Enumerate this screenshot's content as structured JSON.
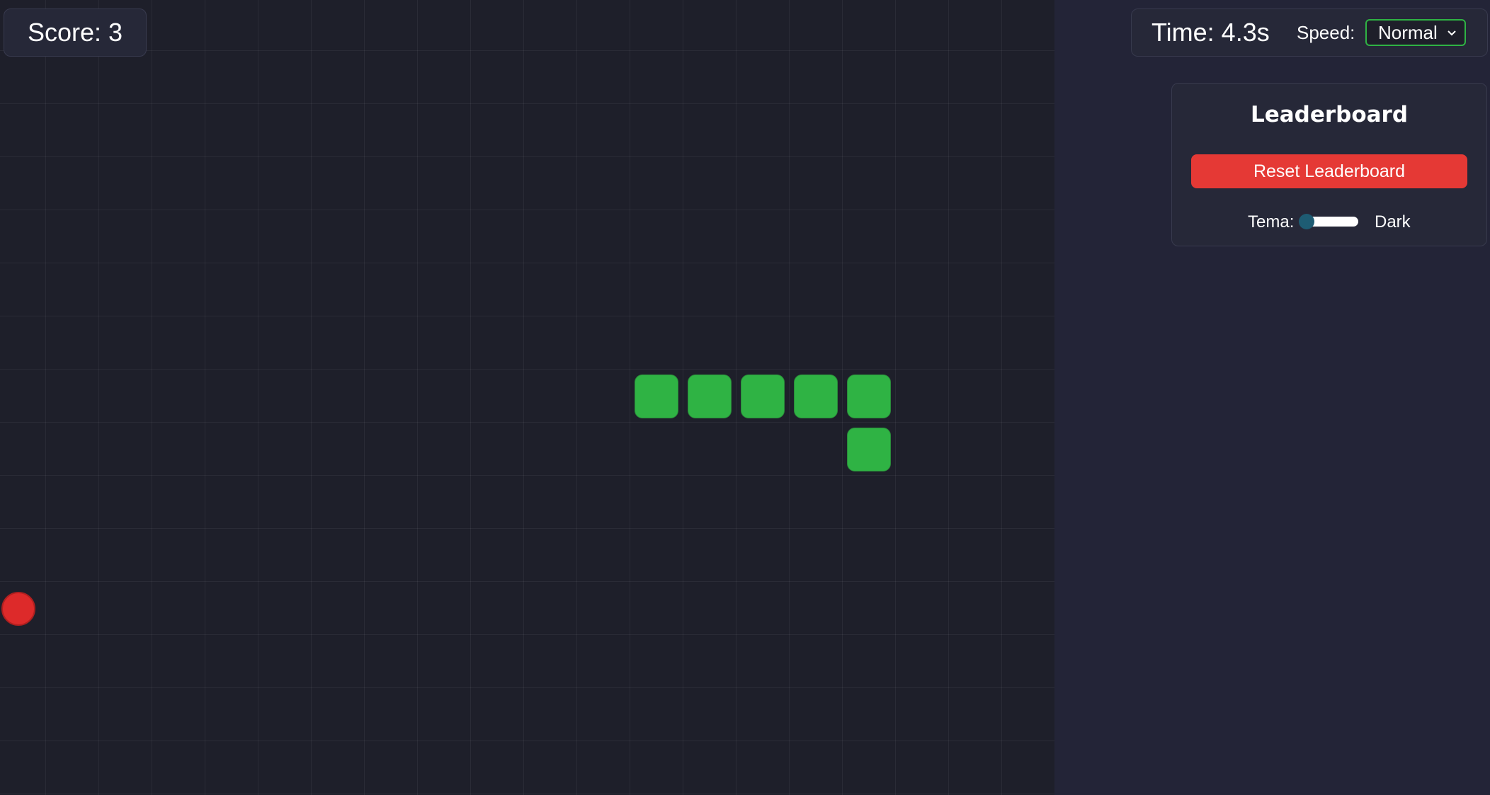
{
  "score": {
    "label": "Score: 3",
    "value": 3
  },
  "timer": {
    "label": "Time: 4.3s"
  },
  "speed": {
    "label": "Speed:",
    "selected": "Normal"
  },
  "leaderboard": {
    "title": "Leaderboard",
    "reset_label": "Reset Leaderboard",
    "theme_label": "Tema:",
    "theme_value": "Dark"
  },
  "game": {
    "snake_length": 6,
    "colors": {
      "snake": "#2fb344",
      "food": "#dd2a2a",
      "board": "#1e1f2a",
      "reset_button": "#e53935"
    }
  }
}
